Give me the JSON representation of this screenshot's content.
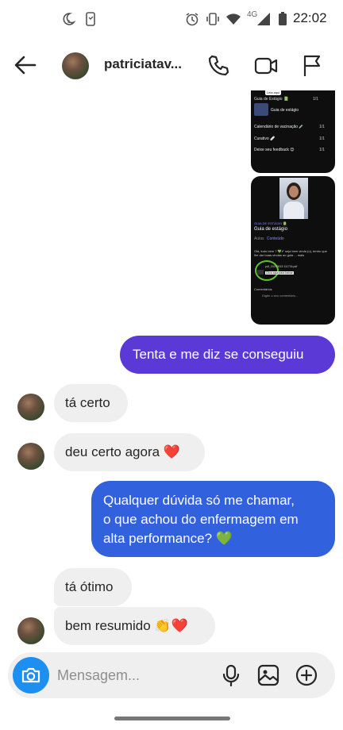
{
  "status_bar": {
    "time": "22:02",
    "network": "4G",
    "icons": [
      "moon-icon",
      "phone-alert-icon",
      "alarm-icon",
      "vibrate-icon",
      "wifi-icon",
      "signal-icon",
      "battery-icon"
    ]
  },
  "header": {
    "contact_name": "patriciatav...",
    "icons": [
      "back-arrow-icon",
      "phone-icon",
      "video-icon",
      "flag-icon"
    ]
  },
  "shared_screenshots": {
    "top": {
      "badge": "Leia aqui",
      "heading": "Guia de Estágio 📗",
      "counter": "1/1",
      "module": "Guia de estágio",
      "rows": [
        {
          "label": "Calendário de vacinação 💉",
          "count": "1/1"
        },
        {
          "label": "Curativo 🩹",
          "count": "1/1"
        },
        {
          "label": "Deixe seu feedback 😊",
          "count": "1/1"
        }
      ]
    },
    "bottom": {
      "section_label": "GUIA DE ESTÁGIO 📗",
      "title": "Guia de estágio",
      "tabs": [
        "Aulas",
        "Conteúdo"
      ],
      "text": "Olá, tudo bem ? 💚✔ seja bem vinda (o), tenho que lhe dar boas-vindas ao guia ... mais",
      "file_name": "pdf_20230515 111734.pdf",
      "file_cta": "Clica aqui para baixar",
      "comments_label": "Comentários",
      "comment_placeholder": "Digite o seu comentário..."
    }
  },
  "messages": [
    {
      "id": "m1",
      "direction": "outgoing",
      "text": "Tenta e me diz se conseguiu"
    },
    {
      "id": "m2",
      "direction": "incoming",
      "text": "tá certo"
    },
    {
      "id": "m3",
      "direction": "incoming",
      "text": "deu certo agora ❤️"
    },
    {
      "id": "m4",
      "direction": "outgoing",
      "lines": [
        "Qualquer dúvida só me chamar,",
        "o que achou do enfermagem em",
        "alta performance? 💚"
      ]
    },
    {
      "id": "m5",
      "direction": "incoming",
      "text": "tá ótimo"
    },
    {
      "id": "m6",
      "direction": "incoming",
      "text": "bem resumido 👏❤️"
    }
  ],
  "composer": {
    "placeholder": "Mensagem...",
    "icons": [
      "camera-icon",
      "microphone-icon",
      "gallery-icon",
      "add-circle-icon"
    ]
  },
  "colors": {
    "purple_bubble": "#5b39d6",
    "blue_bubble": "#3161dd",
    "incoming_bubble": "#efefef",
    "camera_button": "#1d8ff0",
    "success_ring": "#5fc12a"
  }
}
